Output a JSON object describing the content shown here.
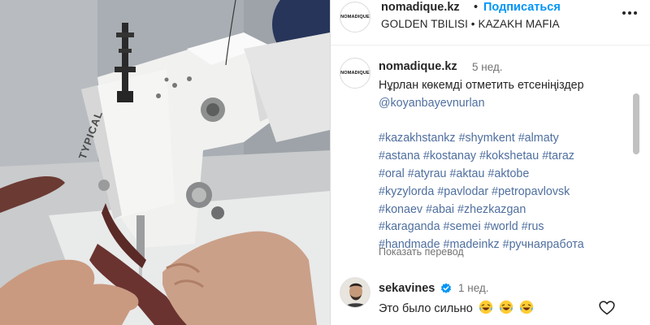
{
  "header": {
    "avatar_logo": "NOMADIQUE",
    "username": "nomadique.kz",
    "separator": "•",
    "follow_label": "Подписаться",
    "subtitle": "GOLDEN TBILISI • KAZAKH MAFIA",
    "more_icon": "ellipsis-icon"
  },
  "media": {
    "machine_label": "TYPICAL"
  },
  "caption": {
    "username": "nomadique.kz",
    "time": "5 нед.",
    "text_line1": "Нұрлан көкемді отметить етсеніңіздер",
    "mention": "@koyanbayevnurlan",
    "hashtag_lines": [
      [
        "#kazakhstankz",
        "#shymkent",
        "#almaty"
      ],
      [
        "#astana",
        "#kostanay",
        "#kokshetau",
        "#taraz"
      ],
      [
        "#oral",
        "#atyrau",
        "#aktau",
        "#aktobe"
      ],
      [
        "#kyzylorda",
        "#pavlodar",
        "#petropavlovsk"
      ],
      [
        "#konaev",
        "#abai",
        "#zhezkazgan"
      ],
      [
        "#karaganda",
        "#semei",
        "#world",
        "#rus"
      ],
      [
        "#handmade",
        "#madeinkz",
        "#ручнаяработа"
      ]
    ],
    "translate_label": "Показать перевод"
  },
  "comment": {
    "username": "sekavines",
    "time": "1 нед.",
    "text": "Это было сильно",
    "emoji_icons": [
      "laughing-emoji-icon",
      "laughing-emoji-icon",
      "laughing-emoji-icon"
    ],
    "like_icon": "heart-outline-icon"
  },
  "colors": {
    "link": "#0095f6",
    "hashtag": "#4f6f9f",
    "secondary_text": "#737373",
    "primary_text": "#262626",
    "verified_badge": "#0095f6"
  }
}
